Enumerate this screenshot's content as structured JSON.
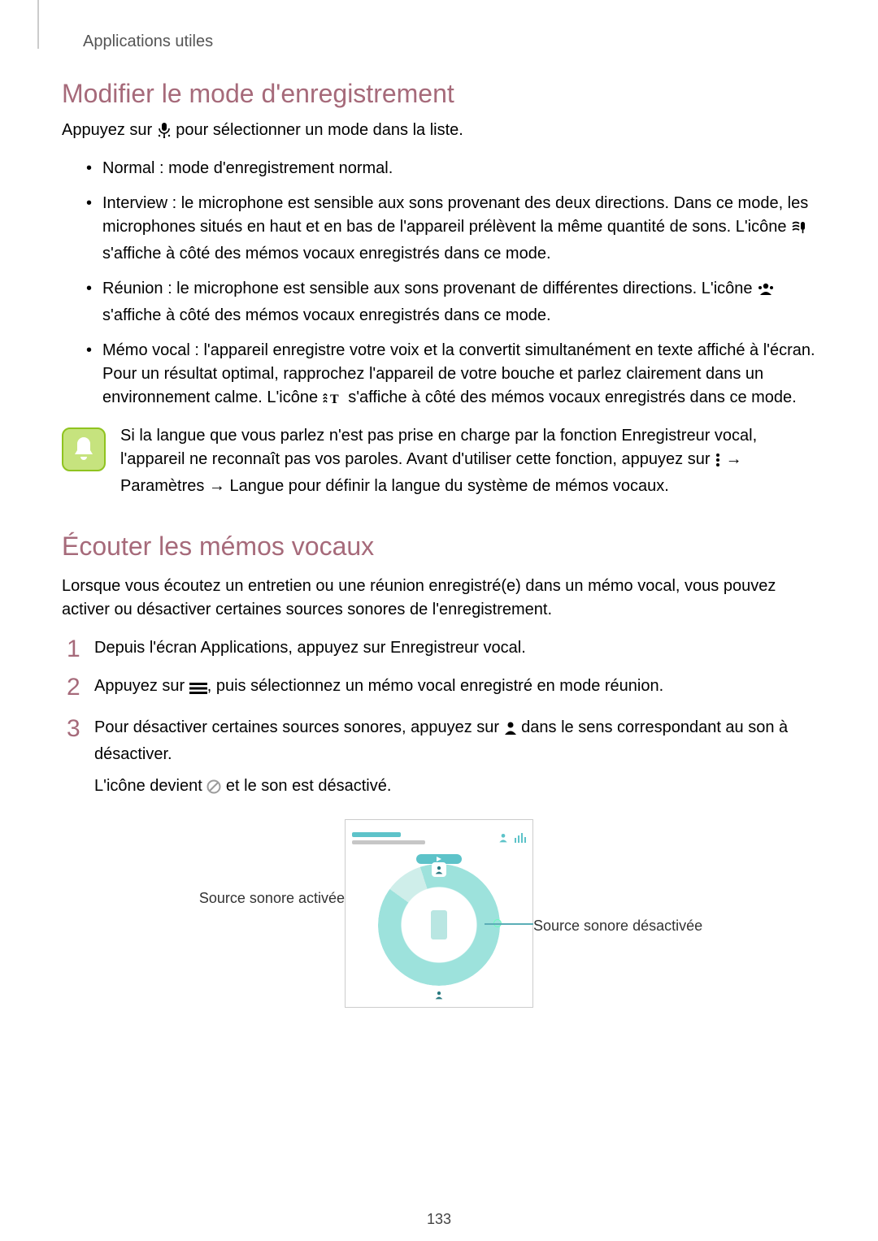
{
  "header": "Applications utiles",
  "h2_1": "Modifier le mode d'enregistrement",
  "p_intro": {
    "before": "Appuyez sur ",
    "after": " pour sélectionner un mode dans la liste."
  },
  "bullets": [
    {
      "label": "Normal",
      "text": " : mode d'enregistrement normal."
    },
    {
      "label": "Interview",
      "seg1": " : le microphone est sensible aux sons provenant des deux directions. Dans ce mode, les microphones situés en haut et en bas de l'appareil prélèvent la même quantité de sons. L'icône ",
      "seg2": " s'affiche à côté des mémos vocaux enregistrés dans ce mode."
    },
    {
      "label": "Réunion",
      "seg1": " : le microphone est sensible aux sons provenant de différentes directions. L'icône ",
      "seg2": " s'affiche à côté des mémos vocaux enregistrés dans ce mode."
    },
    {
      "label": "Mémo vocal",
      "seg1": " : l'appareil enregistre votre voix et la convertit simultanément en texte affiché à l'écran. Pour un résultat optimal, rapprochez l'appareil de votre bouche et parlez clairement dans un environnement calme. L'icône ",
      "seg2": " s'affiche à côté des mémos vocaux enregistrés dans ce mode."
    }
  ],
  "note": {
    "seg1": "Si la langue que vous parlez n'est pas prise en charge par la fonction Enregistreur vocal, l'appareil ne reconnaît pas vos paroles. Avant d'utiliser cette fonction, appuyez sur ",
    "arrow": " → ",
    "b1": "Paramètres",
    "arrow2": " → ",
    "b2": "Langue",
    "seg2": " pour définir la langue du système de mémos vocaux."
  },
  "h2_2": "Écouter les mémos vocaux",
  "p2": "Lorsque vous écoutez un entretien ou une réunion enregistré(e) dans un mémo vocal, vous pouvez activer ou désactiver certaines sources sonores de l'enregistrement.",
  "steps": [
    {
      "seg1": "Depuis l'écran Applications, appuyez sur ",
      "bold": "Enregistreur vocal",
      "seg2": "."
    },
    {
      "seg1": "Appuyez sur ",
      "seg2": ", puis sélectionnez un mémo vocal enregistré en mode réunion."
    },
    {
      "seg1": "Pour désactiver certaines sources sonores, appuyez sur ",
      "seg2": " dans le sens correspondant au son à désactiver.",
      "extra1": "L'icône devient ",
      "extra2": " et le son est désactivé."
    }
  ],
  "diagram": {
    "left_label": "Source sonore activée",
    "right_label": "Source sonore désactivée"
  },
  "page_number": "133"
}
